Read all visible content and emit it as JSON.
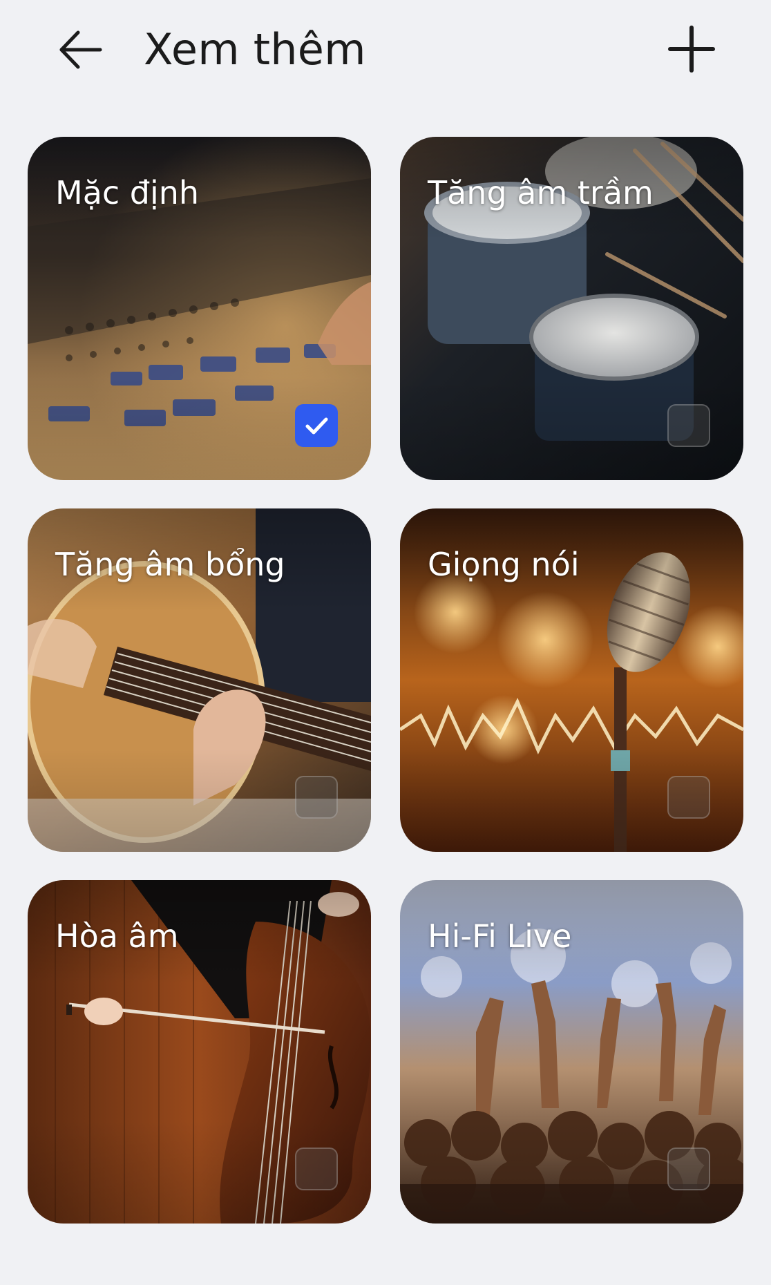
{
  "header": {
    "title": "Xem thêm",
    "back_icon": "arrow-left-icon",
    "add_icon": "plus-icon"
  },
  "presets": [
    {
      "label": "Mặc định",
      "selected": true,
      "image": "mixing-console"
    },
    {
      "label": "Tăng âm trầm",
      "selected": false,
      "image": "drum-kit"
    },
    {
      "label": "Tăng âm bổng",
      "selected": false,
      "image": "acoustic-guitar"
    },
    {
      "label": "Giọng nói",
      "selected": false,
      "image": "vintage-microphone"
    },
    {
      "label": "Hòa âm",
      "selected": false,
      "image": "cello-player"
    },
    {
      "label": "Hi-Fi Live",
      "selected": false,
      "image": "concert-crowd"
    }
  ],
  "colors": {
    "background": "#f0f1f4",
    "title_text": "#1b1b1b",
    "checkbox_selected": "#2f5bf0",
    "card_label": "#ffffff"
  }
}
